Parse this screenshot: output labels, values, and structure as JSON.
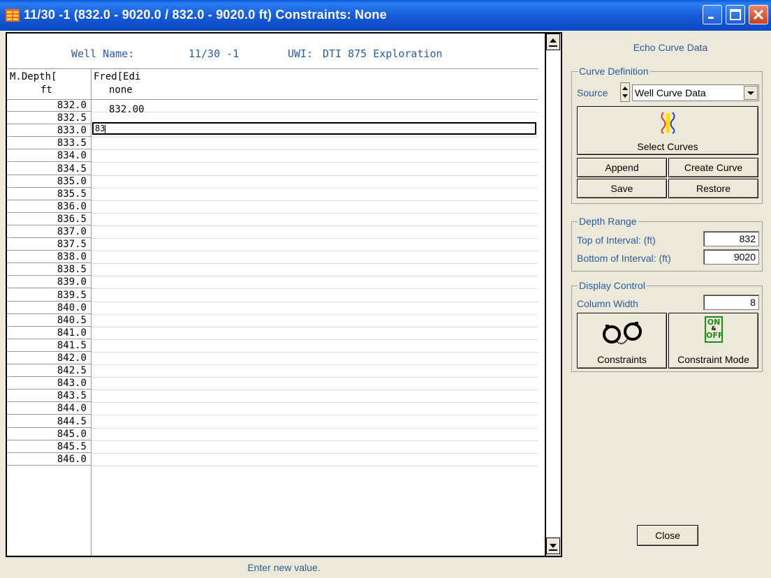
{
  "window": {
    "title": "11/30 -1 (832.0 - 9020.0 / 832.0 - 9020.0 ft) Constraints:  None"
  },
  "grid": {
    "header": {
      "well_name_label": "Well Name:",
      "well_name_value": "11/30 -1",
      "uwi_label": "UWI:",
      "uwi_value": "DTI 875 Exploration"
    },
    "columns": [
      {
        "name": "M.Depth[",
        "unit": "ft"
      },
      {
        "name": "Fred[Edi",
        "unit": "none"
      }
    ],
    "first_value": "832.00",
    "edit_value": "83",
    "depths": [
      "832.0",
      "832.5",
      "833.0",
      "833.5",
      "834.0",
      "834.5",
      "835.0",
      "835.5",
      "836.0",
      "836.5",
      "837.0",
      "837.5",
      "838.0",
      "838.5",
      "839.0",
      "839.5",
      "840.0",
      "840.5",
      "841.0",
      "841.5",
      "842.0",
      "842.5",
      "843.0",
      "843.5",
      "844.0",
      "844.5",
      "845.0",
      "845.5",
      "846.0"
    ]
  },
  "status": "Enter new value.",
  "panel": {
    "title": "Echo Curve Data",
    "curve_definition": {
      "label": "Curve Definition",
      "source_label": "Source",
      "source_value": "Well Curve Data",
      "select_curves": "Select Curves",
      "append": "Append",
      "create_curve": "Create Curve",
      "save": "Save",
      "restore": "Restore"
    },
    "depth_range": {
      "label": "Depth Range",
      "top_label": "Top of Interval:  (ft)",
      "top_value": "832",
      "bottom_label": "Bottom of Interval:  (ft)",
      "bottom_value": "9020"
    },
    "display_control": {
      "label": "Display Control",
      "column_width_label": "Column Width",
      "column_width_value": "8",
      "constraints": "Constraints",
      "constraint_mode": "Constraint Mode",
      "onoff_on": "ON",
      "onoff_amp": "&",
      "onoff_off": "OFF"
    },
    "close": "Close"
  },
  "colors": {
    "title_blue": "#0c49c2",
    "label_blue": "#2b5b9e",
    "face": "#ece9d8",
    "onoff_green": "#1d8a1d"
  }
}
